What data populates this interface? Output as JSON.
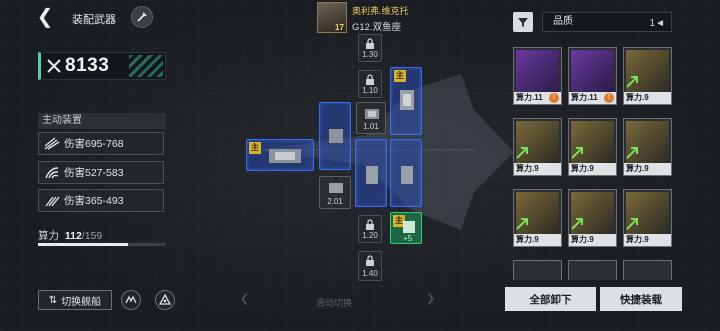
{
  "header": {
    "title": "装配武器"
  },
  "power": {
    "value": "8133"
  },
  "active": {
    "label": "主动装置",
    "rows": [
      "伤害695-768",
      "伤害527-583",
      "伤害365-493"
    ]
  },
  "calc": {
    "label": "算力",
    "current": "112",
    "sep": "/",
    "total": "159",
    "fraction": 0.704
  },
  "bottom": {
    "switch_ship": "切换舰船",
    "slide_hint": "滑动切换"
  },
  "pilot": {
    "name": "奥利弗.维克托",
    "ship": "G12.双鱼座",
    "level": "17"
  },
  "slots": {
    "main_tag": "主",
    "caps": {
      "s1": "1.30",
      "s2": "1.10",
      "s3": "1.01",
      "s4": "2.01",
      "s5": "1.20",
      "s6": "1.40"
    },
    "plus": "+5"
  },
  "filter": {
    "quality_label": "品质"
  },
  "cards": [
    {
      "label": "算力.11",
      "badge": "!"
    },
    {
      "label": "算力.11",
      "badge": "!"
    },
    {
      "label": "算力.9"
    },
    {
      "label": "算力.9"
    },
    {
      "label": "算力.9"
    },
    {
      "label": "算力.9"
    },
    {
      "label": "算力.9"
    },
    {
      "label": "算力.9"
    },
    {
      "label": "算力.9"
    }
  ],
  "actions": {
    "unload_all": "全部卸下",
    "quick_equip": "快捷装载"
  },
  "colors": {
    "accent": "#4fd1b0",
    "slot_blue": "#3b6cf0",
    "main_tag": "#d7b32d",
    "label_gold": "#e7c75a"
  }
}
